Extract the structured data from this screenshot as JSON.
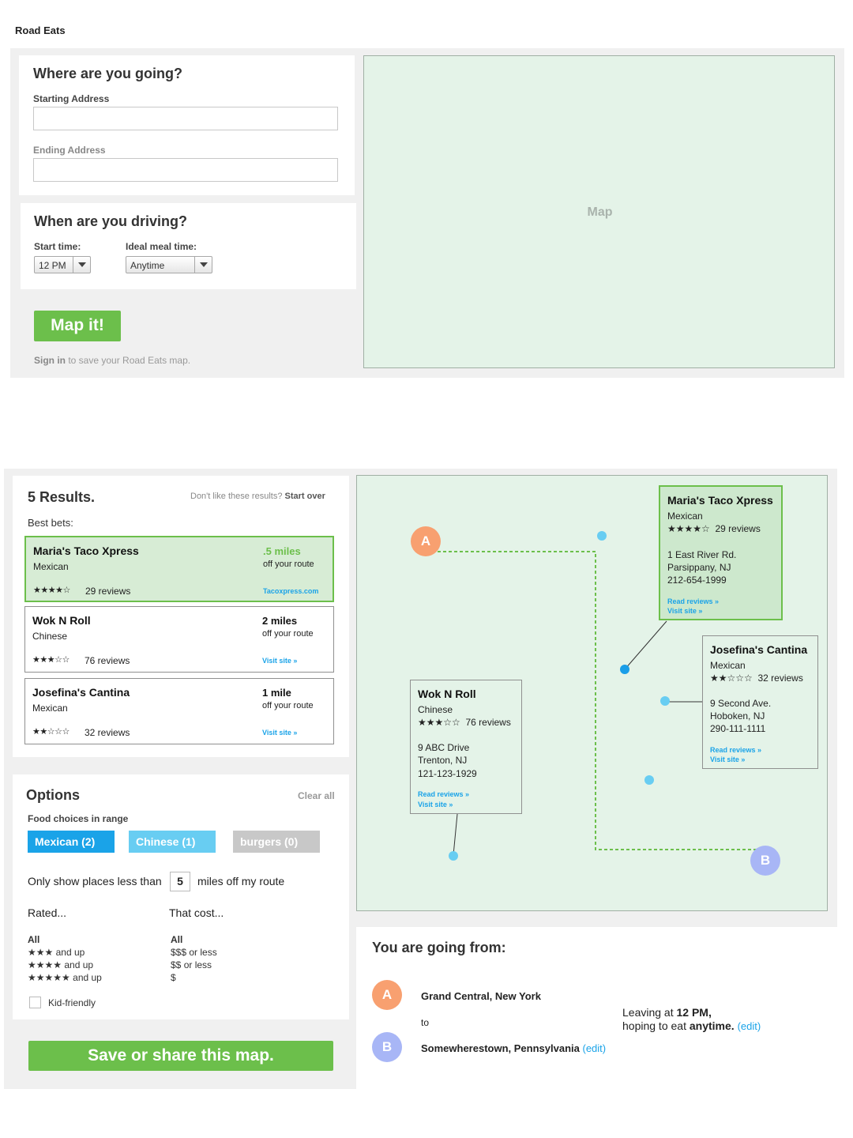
{
  "app": {
    "title": "Road Eats"
  },
  "form": {
    "heading": "Where are you going?",
    "start_label": "Starting Address",
    "start_value": "",
    "end_label": "Ending Address",
    "end_value": "",
    "when_heading": "When are you driving?",
    "start_time_label": "Start time:",
    "start_time_value": "12 PM",
    "meal_label": "Ideal meal time:",
    "meal_value": "Anytime",
    "map_button": "Map it!",
    "signin_link": "Sign in",
    "signin_text": "to save your Road Eats map."
  },
  "map_placeholder": {
    "label": "Map"
  },
  "results": {
    "count_label": "5 Results.",
    "dislike_text": "Don't like these results?",
    "start_over": "Start over",
    "best_bets": "Best bets:",
    "items": [
      {
        "name": "Maria's Taco Xpress",
        "type": "Mexican",
        "stars": "★★★★☆",
        "reviews": "29 reviews",
        "distance": ".5 miles",
        "off": "off your route",
        "link": "Tacoxpress.com"
      },
      {
        "name": "Wok N Roll",
        "type": "Chinese",
        "stars": "★★★☆☆",
        "reviews": "76 reviews",
        "distance": "2 miles",
        "off": "off your route",
        "link": "Visit site »"
      },
      {
        "name": "Josefina's Cantina",
        "type": "Mexican",
        "stars": "★★☆☆☆",
        "reviews": "32 reviews",
        "distance": "1 mile",
        "off": "off your route",
        "link": "Visit site »"
      }
    ]
  },
  "options": {
    "heading": "Options",
    "clear_all": "Clear all",
    "food_label": "Food choices in range",
    "chips": [
      {
        "label": "Mexican (2)",
        "color": "#1aa3e8"
      },
      {
        "label": "Chinese (1)",
        "color": "#68cdf2"
      },
      {
        "label": "burgers (0)",
        "color": "#c8c8c8"
      }
    ],
    "distance_prefix": "Only show places less than",
    "distance_value": "5",
    "distance_suffix": "miles off my route",
    "rated_label": "Rated...",
    "cost_label": "That cost...",
    "rating_all": "All",
    "ratings": [
      {
        "stars": "★★★",
        "text": "and up"
      },
      {
        "stars": "★★★★",
        "text": "and up"
      },
      {
        "stars": "★★★★★",
        "text": "and up"
      }
    ],
    "cost_all": "All",
    "costs": [
      {
        "sym": "$$$",
        "text": "or less"
      },
      {
        "sym": "$$",
        "text": "or less"
      },
      {
        "sym": "$",
        "text": ""
      }
    ],
    "kid_friendly": "Kid-friendly"
  },
  "save_button": "Save or share this map.",
  "map": {
    "marker_a": "A",
    "marker_b": "B",
    "popups": [
      {
        "name": "Maria's Taco Xpress",
        "type": "Mexican",
        "stars": "★★★★☆",
        "reviews": "29 reviews",
        "addr1": "1 East River Rd.",
        "addr2": "Parsippany, NJ",
        "phone": "212-654-1999",
        "read": "Read reviews »",
        "visit": "Visit site »"
      },
      {
        "name": "Josefina's Cantina",
        "type": "Mexican",
        "stars": "★★☆☆☆",
        "reviews": "32 reviews",
        "addr1": "9 Second Ave.",
        "addr2": "Hoboken, NJ",
        "phone": "290-111-1111",
        "read": "Read reviews »",
        "visit": "Visit site »"
      },
      {
        "name": "Wok N Roll",
        "type": "Chinese",
        "stars": "★★★☆☆",
        "reviews": "76 reviews",
        "addr1": "9 ABC Drive",
        "addr2": "Trenton, NJ",
        "phone": "121-123-1929",
        "read": "Read reviews »",
        "visit": "Visit site »"
      }
    ]
  },
  "trip": {
    "heading": "You are going from:",
    "from": "Grand Central, New York",
    "to_word": "to",
    "to": "Somewherestown, Pennsylvania",
    "edit": "(edit)",
    "leaving_prefix": "Leaving at",
    "leaving_time": "12 PM,",
    "hoping_prefix": "hoping to eat",
    "hoping_time": "anytime.",
    "edit2": "(edit)"
  },
  "colors": {
    "accent_green": "#6cbf4b",
    "accent_blue": "#1aa3e8",
    "map_bg": "#e4f3e8",
    "marker_a": "#f8a070",
    "marker_b": "#a8b6f6"
  }
}
